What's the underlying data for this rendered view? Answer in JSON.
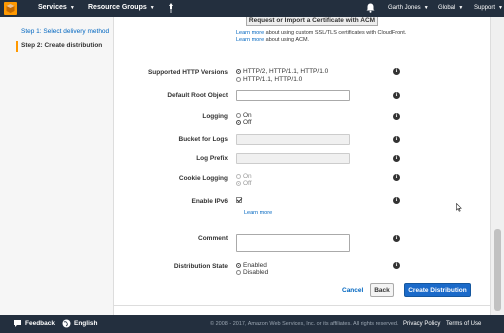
{
  "topbar": {
    "services": "Services",
    "resource_groups": "Resource Groups",
    "user": "Garth Jones",
    "region": "Global",
    "support": "Support"
  },
  "sidebar": {
    "step1": "Step 1: Select delivery method",
    "step2": "Step 2: Create distribution"
  },
  "acm": {
    "button": "Request or Import a Certificate with ACM",
    "note1_link": "Learn more",
    "note1_text": " about using custom SSL/TLS certificates with CloudFront.",
    "note2_link": "Learn more",
    "note2_text": " about using ACM."
  },
  "form": {
    "http_versions": {
      "label": "Supported HTTP Versions",
      "options": [
        "HTTP/2, HTTP/1.1, HTTP/1.0",
        "HTTP/1.1, HTTP/1.0"
      ],
      "selected": "HTTP/2, HTTP/1.1, HTTP/1.0"
    },
    "default_root": {
      "label": "Default Root Object",
      "value": ""
    },
    "logging": {
      "label": "Logging",
      "options": [
        "On",
        "Off"
      ],
      "selected": "Off"
    },
    "bucket_logs": {
      "label": "Bucket for Logs",
      "value": ""
    },
    "log_prefix": {
      "label": "Log Prefix",
      "value": ""
    },
    "cookie_logging": {
      "label": "Cookie Logging",
      "options": [
        "On",
        "Off"
      ],
      "selected": "Off"
    },
    "ipv6": {
      "label": "Enable IPv6",
      "checked": true,
      "learn_more": "Learn more"
    },
    "comment": {
      "label": "Comment",
      "value": ""
    },
    "state": {
      "label": "Distribution State",
      "options": [
        "Enabled",
        "Disabled"
      ],
      "selected": "Enabled"
    },
    "info_glyph": "i"
  },
  "actions": {
    "cancel": "Cancel",
    "back": "Back",
    "create": "Create Distribution"
  },
  "footer": {
    "feedback": "Feedback",
    "language": "English",
    "copyright": "© 2008 - 2017, Amazon Web Services, Inc. or its affiliates. All rights reserved.",
    "privacy": "Privacy Policy",
    "terms": "Terms of Use"
  },
  "colors": {
    "nav_bg": "#232f3e",
    "link": "#0066c0",
    "primary": "#1b6ac9",
    "accent": "#ff9900"
  }
}
